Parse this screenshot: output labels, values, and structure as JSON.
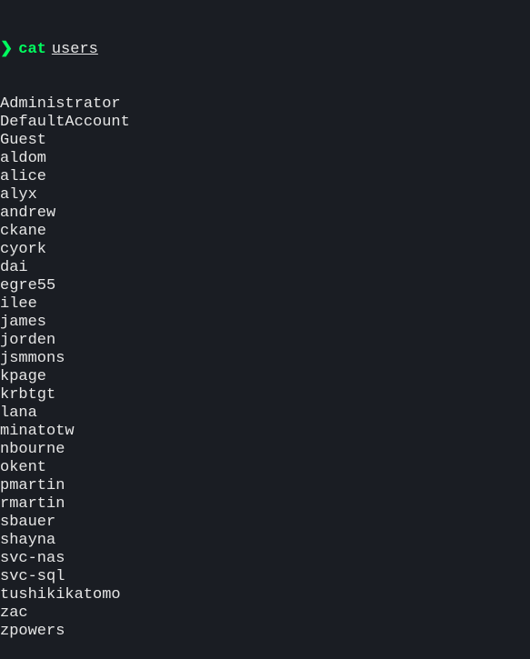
{
  "prompt": {
    "arrow": "❯",
    "command": "cat",
    "argument": "users"
  },
  "output": [
    "Administrator",
    "DefaultAccount",
    "Guest",
    "aldom",
    "alice",
    "alyx",
    "andrew",
    "ckane",
    "cyork",
    "dai",
    "egre55",
    "ilee",
    "james",
    "jorden",
    "jsmmons",
    "kpage",
    "krbtgt",
    "lana",
    "minatotw",
    "nbourne",
    "okent",
    "pmartin",
    "rmartin",
    "sbauer",
    "shayna",
    "svc-nas",
    "svc-sql",
    "tushikikatomo",
    "zac",
    "zpowers"
  ]
}
